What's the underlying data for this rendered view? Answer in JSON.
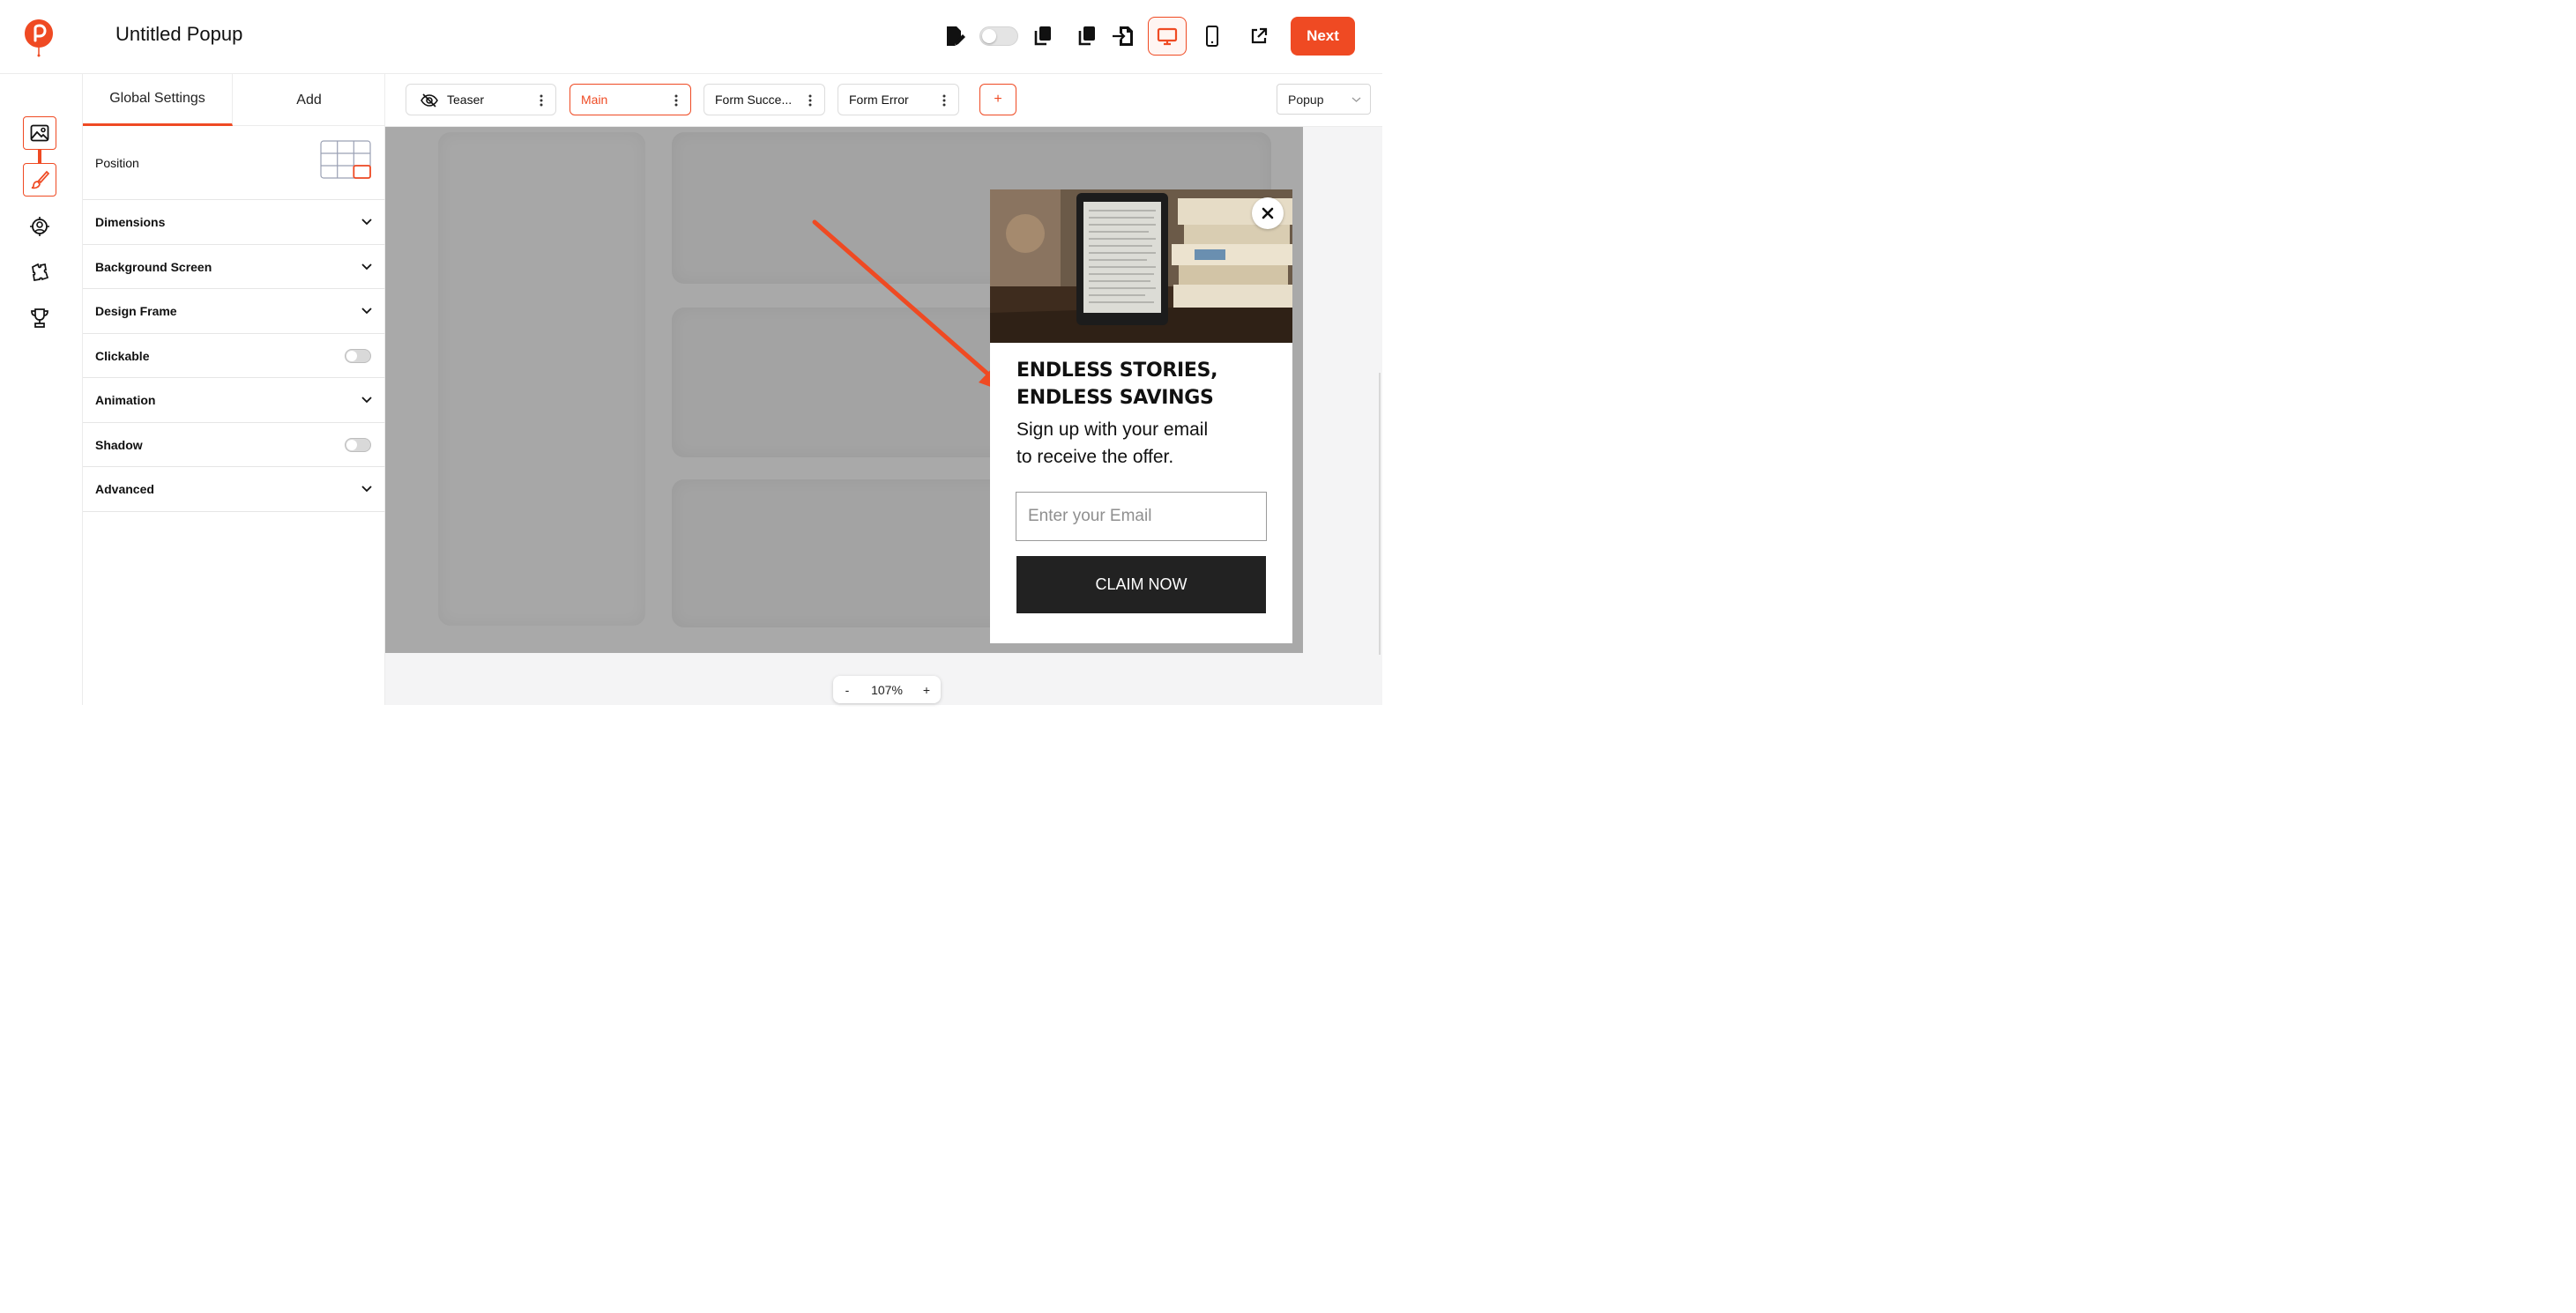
{
  "header": {
    "title": "Untitled Popup",
    "next_label": "Next"
  },
  "panel": {
    "tabs": [
      "Global Settings",
      "Add"
    ],
    "active_tab": "Global Settings",
    "rows": {
      "position": "Position",
      "dimensions": "Dimensions",
      "background_screen": "Background Screen",
      "design_frame": "Design Frame",
      "clickable": "Clickable",
      "animation": "Animation",
      "shadow": "Shadow",
      "advanced": "Advanced"
    },
    "clickable_enabled": false,
    "shadow_enabled": false,
    "selected_position": "bottom-right"
  },
  "steps": {
    "items": [
      "Teaser",
      "Main",
      "Form Succe...",
      "Form Error"
    ],
    "active": "Main",
    "add_label": "+"
  },
  "display_type": "Popup",
  "popup": {
    "headline_line1": "ENDLESS STORIES,",
    "headline_line2": "ENDLESS SAVINGS",
    "sub_line1": "Sign up with your email",
    "sub_line2": "to receive the offer.",
    "email_placeholder": "Enter your Email",
    "cta_label": "CLAIM NOW"
  },
  "zoom": {
    "minus": "-",
    "value": "107%",
    "plus": "+"
  },
  "colors": {
    "accent": "#ef4a23",
    "cta_bg": "#222222",
    "canvas_overlay": "#a9a9a9"
  }
}
